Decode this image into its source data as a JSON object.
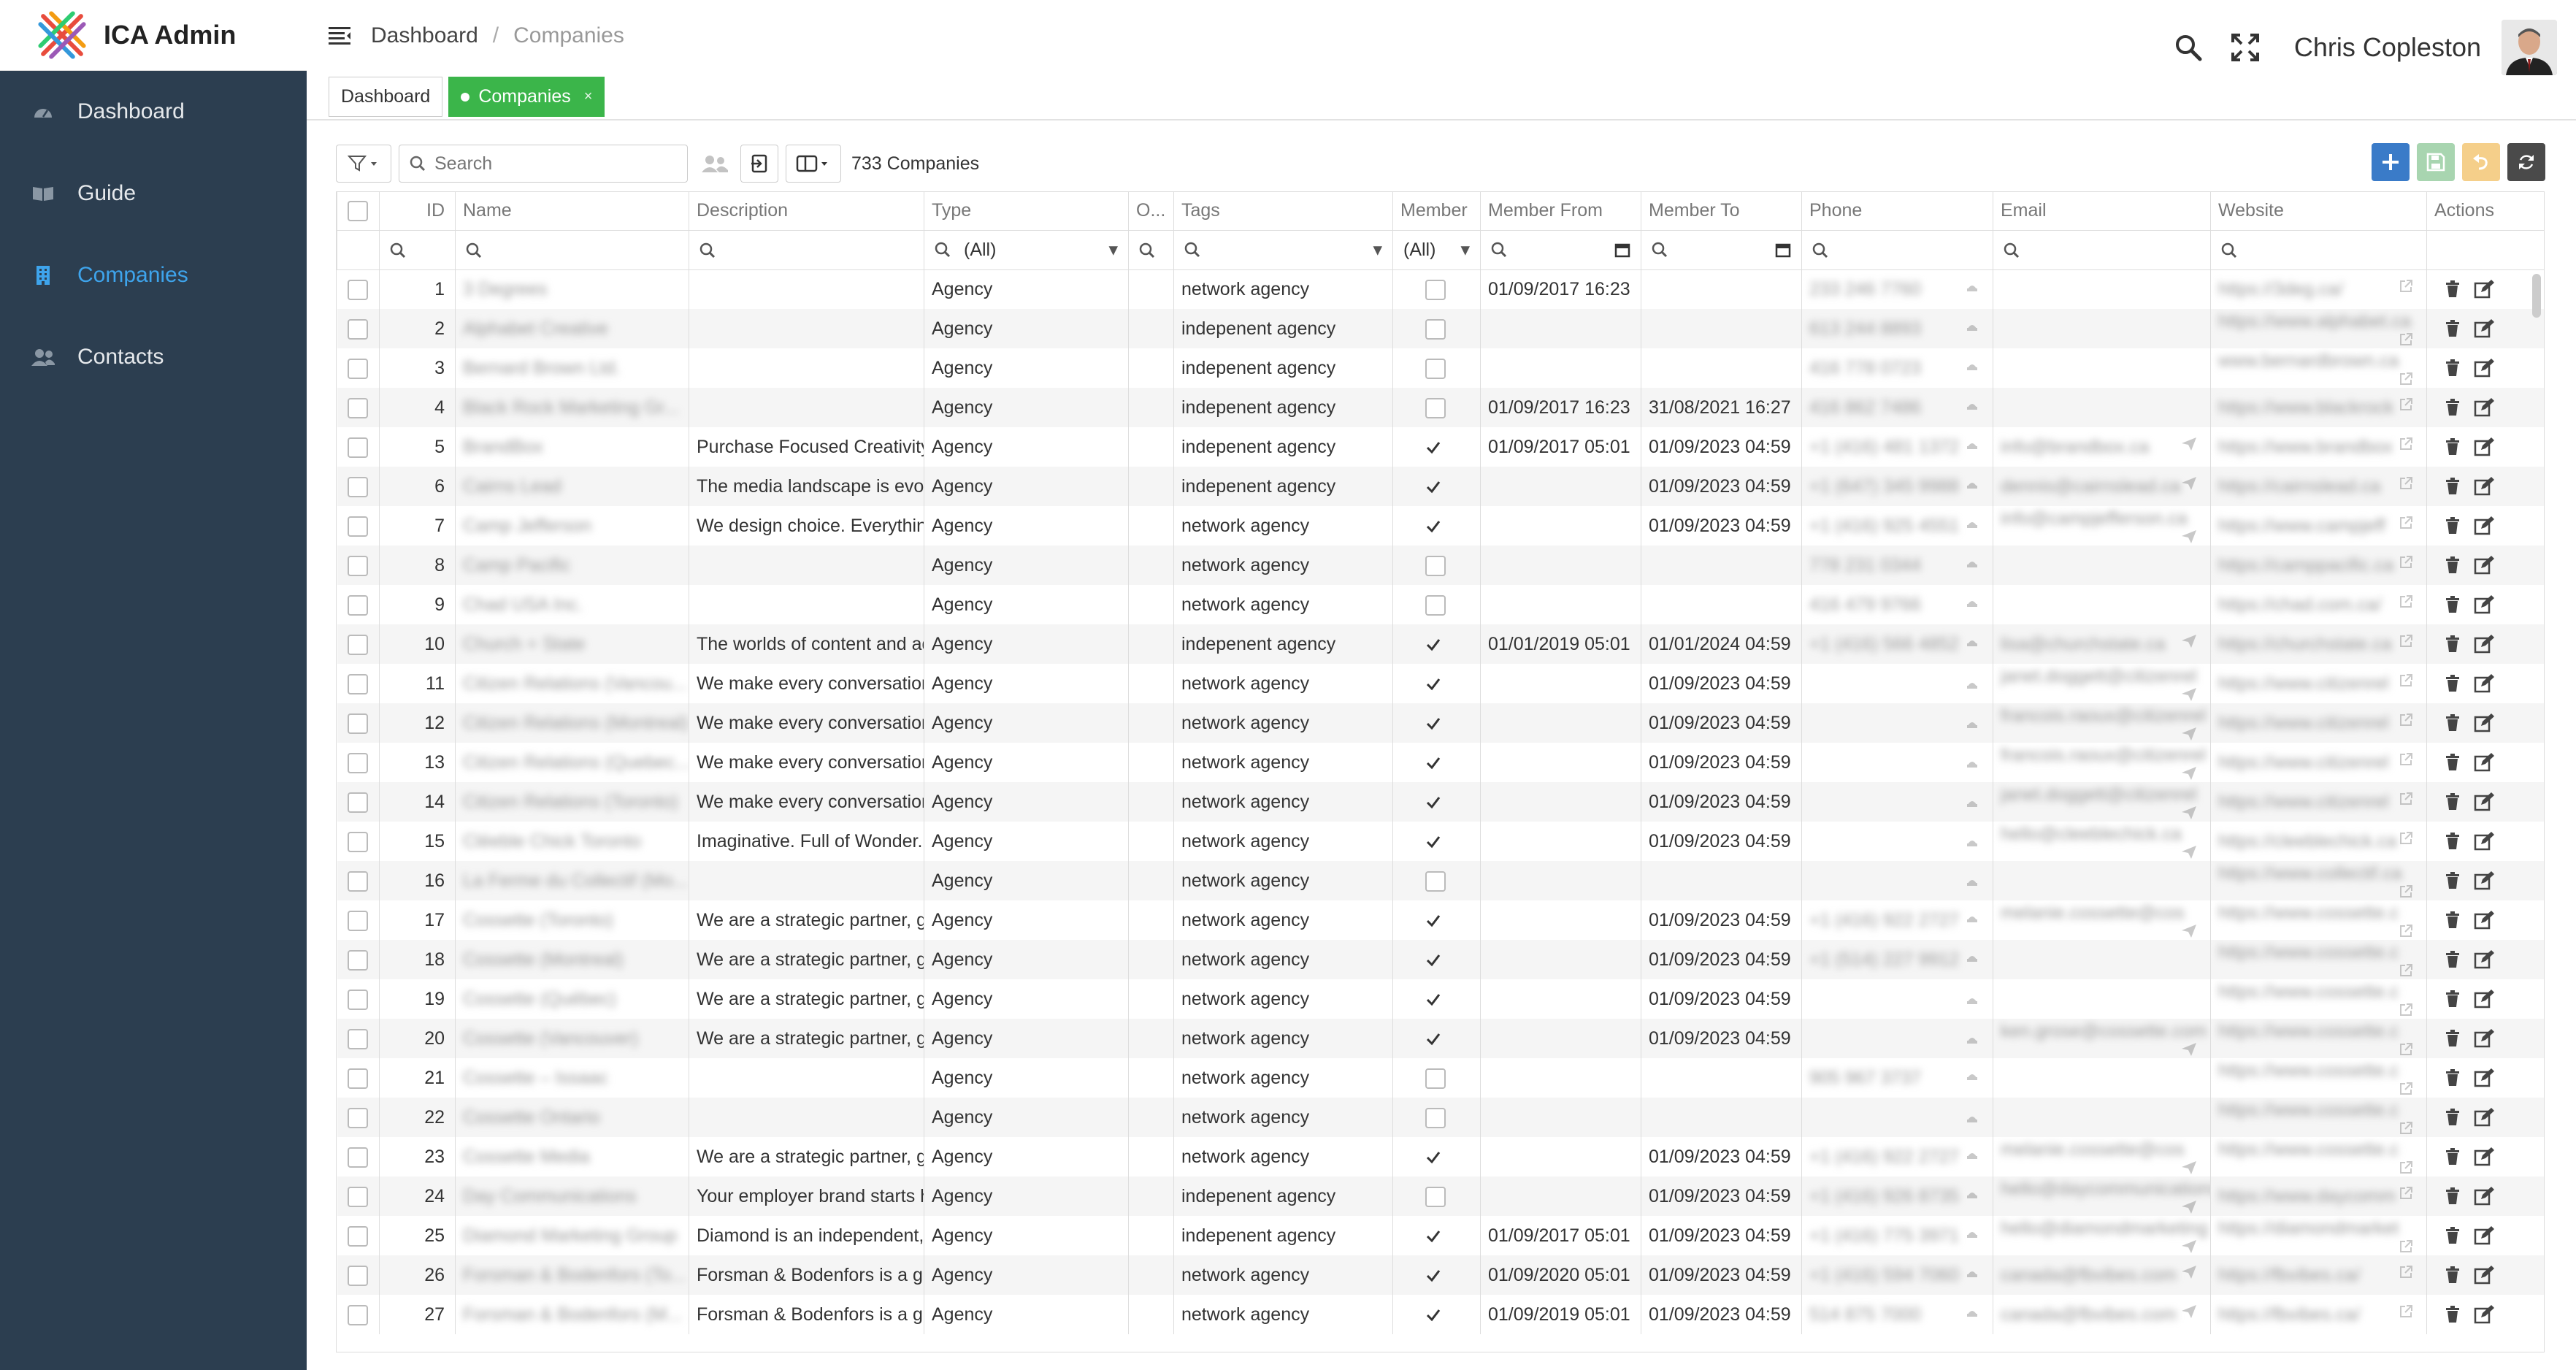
{
  "app": {
    "name": "ICA Admin"
  },
  "sidebar": {
    "items": [
      {
        "label": "Dashboard",
        "icon": "dashboard-gauge-icon"
      },
      {
        "label": "Guide",
        "icon": "book-icon"
      },
      {
        "label": "Companies",
        "icon": "building-icon",
        "active": true
      },
      {
        "label": "Contacts",
        "icon": "users-icon"
      }
    ]
  },
  "header": {
    "breadcrumb": [
      "Dashboard",
      "Companies"
    ],
    "user": {
      "name": "Chris Copleston"
    }
  },
  "tabs": [
    {
      "label": "Dashboard",
      "active": false
    },
    {
      "label": "Companies",
      "active": true
    }
  ],
  "toolbar": {
    "search_placeholder": "Search",
    "count_text": "733 Companies"
  },
  "colors": {
    "sidebar": "#2c3e50",
    "accent": "#3ea4ec",
    "tab_active": "#3bb54a",
    "add": "#3a7bc8",
    "save": "#a8d5b0",
    "undo": "#f5cf8a",
    "refresh": "#4a4a4a"
  },
  "table": {
    "columns": [
      "ID",
      "Name",
      "Description",
      "Type",
      "O...",
      "Tags",
      "Member",
      "Member From",
      "Member To",
      "Phone",
      "Email",
      "Website",
      "Actions"
    ],
    "filters": {
      "type": "(All)",
      "member": "(All)"
    },
    "rows": [
      {
        "id": "1",
        "name": "3 Degrees",
        "desc": "",
        "type": "Agency",
        "tags": "network agency",
        "member": false,
        "from": "01/09/2017 16:23",
        "to": "",
        "phone": "233 246 7760",
        "email": "",
        "web": "https://3deg.ca/"
      },
      {
        "id": "2",
        "name": "Alphabet Creative",
        "desc": "",
        "type": "Agency",
        "tags": "indepenent agency",
        "member": false,
        "from": "",
        "to": "",
        "phone": "613 244 8893",
        "email": "",
        "web": "https://www.alphabet.ca"
      },
      {
        "id": "3",
        "name": "Bernard Brown Ltd.",
        "desc": "",
        "type": "Agency",
        "tags": "indepenent agency",
        "member": false,
        "from": "",
        "to": "",
        "phone": "416 778 0723",
        "email": "",
        "web": "www.bernardbrown.ca"
      },
      {
        "id": "4",
        "name": "Black Rock Marketing Gr...",
        "desc": "",
        "type": "Agency",
        "tags": "indepenent agency",
        "member": false,
        "from": "01/09/2017 16:23",
        "to": "31/08/2021 16:27",
        "phone": "416 862 7486",
        "email": "",
        "web": "https://www.blackrock"
      },
      {
        "id": "5",
        "name": "BrandBox",
        "desc": "Purchase Focused Creativity.",
        "type": "Agency",
        "tags": "indepenent agency",
        "member": true,
        "from": "01/09/2017 05:01",
        "to": "01/09/2023 04:59",
        "phone": "+1 (416) 481 1372",
        "email": "info@brandbox.ca",
        "web": "https://www.brandbox"
      },
      {
        "id": "6",
        "name": "Cairns Lead",
        "desc": "The media landscape is evolving",
        "type": "Agency",
        "tags": "indepenent agency",
        "member": true,
        "from": "",
        "to": "01/09/2023 04:59",
        "phone": "+1 (647) 345 9988",
        "email": "dennis@cairnslead.ca",
        "web": "https://cairnslead.ca"
      },
      {
        "id": "7",
        "name": "Camp Jefferson",
        "desc": "We design choice. Everything",
        "type": "Agency",
        "tags": "network agency",
        "member": true,
        "from": "",
        "to": "01/09/2023 04:59",
        "phone": "+1 (416) 925 4551",
        "email": "info@campjefferson.ca",
        "web": "https://www.campjeff"
      },
      {
        "id": "8",
        "name": "Camp Pacific",
        "desc": "",
        "type": "Agency",
        "tags": "network agency",
        "member": false,
        "from": "",
        "to": "",
        "phone": "778 231 0344",
        "email": "",
        "web": "https://camppacific.ca"
      },
      {
        "id": "9",
        "name": "Chad USA Inc.",
        "desc": "",
        "type": "Agency",
        "tags": "network agency",
        "member": false,
        "from": "",
        "to": "",
        "phone": "416 479 9766",
        "email": "",
        "web": "https://chad.com.ca/"
      },
      {
        "id": "10",
        "name": "Church + State",
        "desc": "The worlds of content and advertising",
        "type": "Agency",
        "tags": "indepenent agency",
        "member": true,
        "from": "01/01/2019 05:01",
        "to": "01/01/2024 04:59",
        "phone": "+1 (416) 566 4852",
        "email": "lisa@churchstate.ca",
        "web": "https://churchstate.ca"
      },
      {
        "id": "11",
        "name": "Citizen Relations (Vancou...",
        "desc": "We make every conversation count",
        "type": "Agency",
        "tags": "network agency",
        "member": true,
        "from": "",
        "to": "01/09/2023 04:59",
        "phone": "",
        "email": "janet.doggett@citizenrel",
        "web": "https://www.citizenrel"
      },
      {
        "id": "12",
        "name": "Citizen Relations (Montreal)",
        "desc": "We make every conversation count",
        "type": "Agency",
        "tags": "network agency",
        "member": true,
        "from": "",
        "to": "01/09/2023 04:59",
        "phone": "",
        "email": "francois.raoux@citizenrel",
        "web": "https://www.citizenrel"
      },
      {
        "id": "13",
        "name": "Citizen Relations (Quebec...",
        "desc": "We make every conversation count",
        "type": "Agency",
        "tags": "network agency",
        "member": true,
        "from": "",
        "to": "01/09/2023 04:59",
        "phone": "",
        "email": "francois.raoux@citizenrel",
        "web": "https://www.citizenrel"
      },
      {
        "id": "14",
        "name": "Citizen Relations (Toronto)",
        "desc": "We make every conversation count",
        "type": "Agency",
        "tags": "network agency",
        "member": true,
        "from": "",
        "to": "01/09/2023 04:59",
        "phone": "",
        "email": "janet.doggett@citizenrel",
        "web": "https://www.citizenrel"
      },
      {
        "id": "15",
        "name": "Cléeble Chick Toronto",
        "desc": "Imaginative. Full of Wonder. Bold.",
        "type": "Agency",
        "tags": "network agency",
        "member": true,
        "from": "",
        "to": "01/09/2023 04:59",
        "phone": "",
        "email": "hello@cleeblechick.ca",
        "web": "https://cleeblechick.ca"
      },
      {
        "id": "16",
        "name": "La Ferme du Collectif (Mo...",
        "desc": "",
        "type": "Agency",
        "tags": "network agency",
        "member": false,
        "from": "",
        "to": "",
        "phone": "",
        "email": "",
        "web": "https://www.collectif.ca"
      },
      {
        "id": "17",
        "name": "Cossette (Toronto)",
        "desc": "We are a strategic partner, getting",
        "type": "Agency",
        "tags": "network agency",
        "member": true,
        "from": "",
        "to": "01/09/2023 04:59",
        "phone": "+1 (416) 922 2727",
        "email": "melanie.cossette@cos",
        "web": "https://www.cossette.c"
      },
      {
        "id": "18",
        "name": "Cossette (Montreal)",
        "desc": "We are a strategic partner, getting",
        "type": "Agency",
        "tags": "network agency",
        "member": true,
        "from": "",
        "to": "01/09/2023 04:59",
        "phone": "+1 (514) 227 9912",
        "email": "",
        "web": "https://www.cossette.c"
      },
      {
        "id": "19",
        "name": "Cossette (Québec)",
        "desc": "We are a strategic partner, getting",
        "type": "Agency",
        "tags": "network agency",
        "member": true,
        "from": "",
        "to": "01/09/2023 04:59",
        "phone": "",
        "email": "",
        "web": "https://www.cossette.c"
      },
      {
        "id": "20",
        "name": "Cossette (Vancouver)",
        "desc": "We are a strategic partner, getting",
        "type": "Agency",
        "tags": "network agency",
        "member": true,
        "from": "",
        "to": "01/09/2023 04:59",
        "phone": "",
        "email": "ken.grose@cossette.com",
        "web": "https://www.cossette.c"
      },
      {
        "id": "21",
        "name": "Cossette – Issaac",
        "desc": "",
        "type": "Agency",
        "tags": "network agency",
        "member": false,
        "from": "",
        "to": "",
        "phone": "905 967 3737",
        "email": "",
        "web": "https://www.cossette.c"
      },
      {
        "id": "22",
        "name": "Cossette Ontario",
        "desc": "",
        "type": "Agency",
        "tags": "network agency",
        "member": false,
        "from": "",
        "to": "",
        "phone": "",
        "email": "",
        "web": "https://www.cossette.c"
      },
      {
        "id": "23",
        "name": "Cossette Media",
        "desc": "We are a strategic partner, getting",
        "type": "Agency",
        "tags": "network agency",
        "member": true,
        "from": "",
        "to": "01/09/2023 04:59",
        "phone": "+1 (416) 922 2727",
        "email": "melanie.cossette@cos",
        "web": "https://www.cossette.c"
      },
      {
        "id": "24",
        "name": "Day Communications",
        "desc": "Your employer brand starts here",
        "type": "Agency",
        "tags": "indepenent agency",
        "member": false,
        "from": "",
        "to": "01/09/2023 04:59",
        "phone": "+1 (416) 926 8735",
        "email": "hello@daycommunications",
        "web": "https://www.daycomm"
      },
      {
        "id": "25",
        "name": "Diamond Marketing Group",
        "desc": "Diamond is an independent, integrated",
        "type": "Agency",
        "tags": "indepenent agency",
        "member": true,
        "from": "01/09/2017 05:01",
        "to": "01/09/2023 04:59",
        "phone": "+1 (416) 775 3971",
        "email": "hello@diamondmarketing",
        "web": "https://diamondmarket"
      },
      {
        "id": "26",
        "name": "Forsman & Bodenfors (To...",
        "desc": "Forsman & Bodenfors is a global",
        "type": "Agency",
        "tags": "network agency",
        "member": true,
        "from": "01/09/2020 05:01",
        "to": "01/09/2023 04:59",
        "phone": "+1 (416) 594 7060",
        "email": "canada@fbvibes.com",
        "web": "https://fbvibes.ca/"
      },
      {
        "id": "27",
        "name": "Forsman & Bodenfors (M...",
        "desc": "Forsman & Bodenfors is a global",
        "type": "Agency",
        "tags": "network agency",
        "member": true,
        "from": "01/09/2019 05:01",
        "to": "01/09/2023 04:59",
        "phone": "514 875 7000",
        "email": "canada@fbvibes.com",
        "web": "https://fbvibes.ca/"
      }
    ]
  }
}
